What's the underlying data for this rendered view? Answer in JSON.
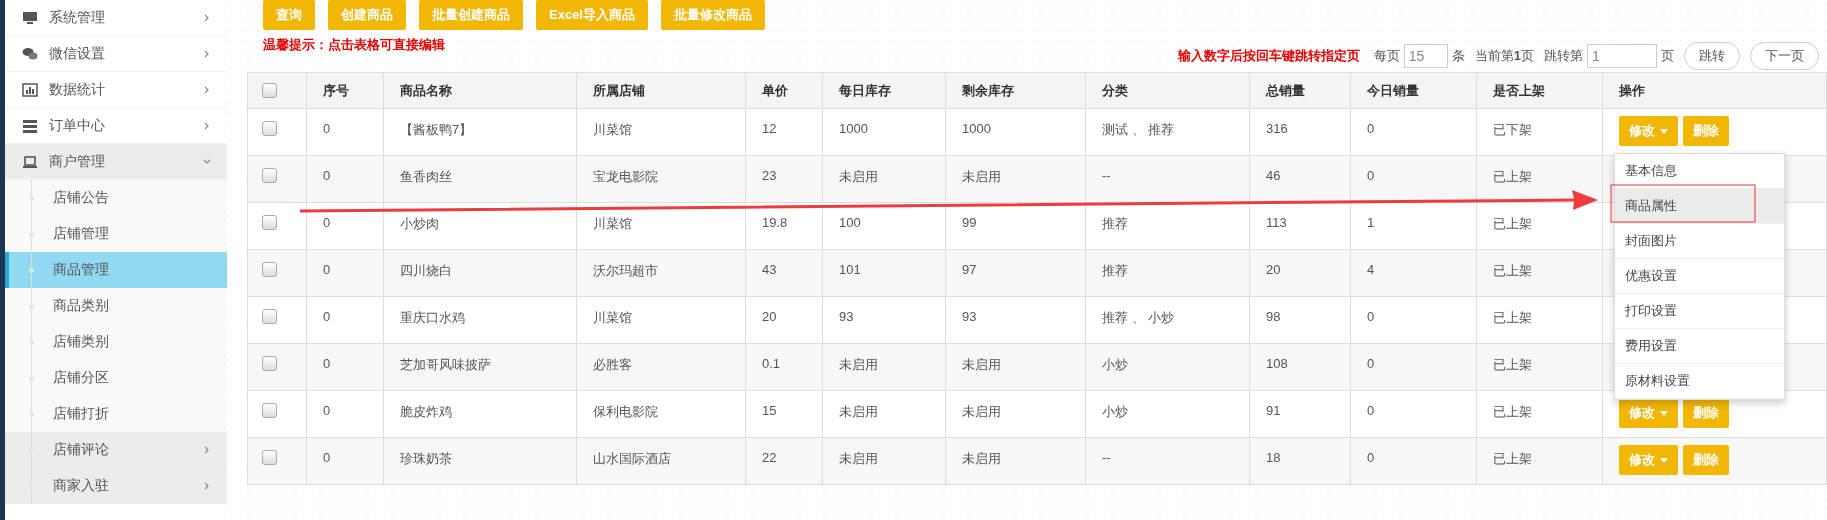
{
  "sidebar": {
    "items": [
      {
        "label": "系统管理",
        "expanded": false,
        "selected": false
      },
      {
        "label": "微信设置",
        "expanded": false,
        "selected": false
      },
      {
        "label": "数据统计",
        "expanded": false,
        "selected": false
      },
      {
        "label": "订单中心",
        "expanded": false,
        "selected": false
      },
      {
        "label": "商户管理",
        "expanded": true,
        "selected": false,
        "children": [
          {
            "label": "店铺公告",
            "kind": "link",
            "selected": false
          },
          {
            "label": "店铺管理",
            "kind": "link",
            "selected": false
          },
          {
            "label": "商品管理",
            "kind": "link",
            "selected": true
          },
          {
            "label": "商品类别",
            "kind": "link",
            "selected": false
          },
          {
            "label": "店铺类别",
            "kind": "link",
            "selected": false
          },
          {
            "label": "店铺分区",
            "kind": "link",
            "selected": false
          },
          {
            "label": "店铺打折",
            "kind": "link",
            "selected": false
          },
          {
            "label": "店铺评论",
            "kind": "group",
            "selected": false
          },
          {
            "label": "商家入驻",
            "kind": "group",
            "selected": false
          }
        ]
      }
    ]
  },
  "toolbar": {
    "buttons": [
      "查询",
      "创建商品",
      "批量创建商品",
      "Excel导入商品",
      "批量修改商品"
    ]
  },
  "tip": "温馨提示：点击表格可直接编辑",
  "pagination": {
    "hint": "输入数字后按回车键跳转指定页",
    "per_page_label": "每页",
    "per_page": "15",
    "per_page_unit": "条",
    "current": "当前第**1**页",
    "jump_label": "跳转第",
    "jump_value": "1",
    "jump_unit": "页",
    "jump_button": "跳转",
    "next_button": "下一页"
  },
  "table": {
    "select_all": {
      "checked": false
    },
    "columns": [
      "序号",
      "商品名称",
      "所属店铺",
      "单价",
      "每日库存",
      "剩余库存",
      "分类",
      "总销量",
      "今日销量",
      "是否上架",
      "操作"
    ],
    "rows": [
      {
        "checked": false,
        "cells": [
          "0",
          "【酱板鸭7】",
          "川菜馆",
          "12",
          "1000",
          "1000",
          "测试 、 推荐",
          "316",
          "0",
          "已下架"
        ],
        "actions": {
          "edit": "修改",
          "delete": "删除"
        }
      },
      {
        "checked": false,
        "cells": [
          "0",
          "鱼香肉丝",
          "宝龙电影院",
          "23",
          "未启用",
          "未启用",
          "--",
          "46",
          "0",
          "已上架"
        ]
      },
      {
        "checked": false,
        "cells": [
          "0",
          "小炒肉",
          "川菜馆",
          "19.8",
          "100",
          "99",
          "推荐",
          "113",
          "1",
          "已上架"
        ]
      },
      {
        "checked": false,
        "cells": [
          "0",
          "四川烧白",
          "沃尔玛超市",
          "43",
          "101",
          "97",
          "推荐",
          "20",
          "4",
          "已上架"
        ]
      },
      {
        "checked": false,
        "cells": [
          "0",
          "重庆口水鸡",
          "川菜馆",
          "20",
          "93",
          "93",
          "推荐 、 小炒",
          "98",
          "0",
          "已上架"
        ]
      },
      {
        "checked": false,
        "cells": [
          "0",
          "芝加哥风味披萨",
          "必胜客",
          "0.1",
          "未启用",
          "未启用",
          "小炒",
          "108",
          "0",
          "已上架"
        ]
      },
      {
        "checked": false,
        "cells": [
          "0",
          "脆皮炸鸡",
          "保利电影院",
          "15",
          "未启用",
          "未启用",
          "小炒",
          "91",
          "0",
          "已上架"
        ],
        "actions": {
          "edit": "修改",
          "delete": "删除"
        }
      },
      {
        "checked": false,
        "cells": [
          "0",
          "珍珠奶茶",
          "山水国际酒店",
          "22",
          "未启用",
          "未启用",
          "--",
          "18",
          "0",
          "已上架"
        ],
        "actions": {
          "edit": "修改",
          "delete": "删除"
        }
      }
    ]
  },
  "dropdown": {
    "items": [
      {
        "label": "基本信息",
        "selected": false
      },
      {
        "label": "商品属性",
        "selected": true
      },
      {
        "label": "封面图片",
        "selected": false
      },
      {
        "label": "优惠设置",
        "selected": false
      },
      {
        "label": "打印设置",
        "selected": false
      },
      {
        "label": "费用设置",
        "selected": false
      },
      {
        "label": "原材料设置",
        "selected": false
      }
    ]
  }
}
